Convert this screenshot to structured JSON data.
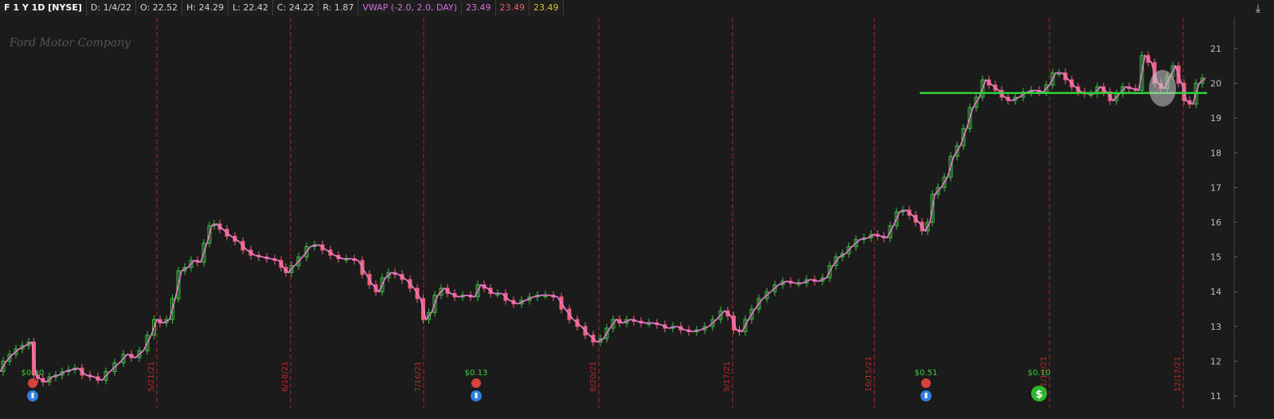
{
  "header": {
    "symbol": "F 1 Y 1D [NYSE]",
    "date": "D: 1/4/22",
    "open": "O: 22.52",
    "high": "H: 24.29",
    "low": "L: 22.42",
    "close": "C: 24.22",
    "range": "R: 1.87",
    "vwap_label": "VWAP (-2.0, 2.0, DAY)",
    "vwap_values": [
      "23.49",
      "23.49",
      "23.49"
    ]
  },
  "watermark": "Ford Motor Company",
  "colors": {
    "background": "#1b1b1b",
    "up": "#3fbf3f",
    "down": "#f0637a",
    "vwap": "#e97ad7",
    "vline": "#b0202a",
    "level": "#2fd23a",
    "grid": "#2a2a2a"
  },
  "chart_data": {
    "type": "line",
    "title": "",
    "xlabel": "",
    "ylabel": "",
    "ylim": [
      10.7,
      21.6
    ],
    "y_ticks": [
      "21",
      "20",
      "19",
      "18",
      "17",
      "16",
      "15",
      "14",
      "13",
      "12",
      "11"
    ],
    "x_date_labels": [
      "5/21/21",
      "6/18/21",
      "7/16/21",
      "8/20/21",
      "9/17/21",
      "10/15/21",
      "11/19/21",
      "12/17/21"
    ],
    "horizontal_level": 19.72,
    "close_series": [
      [
        0,
        11.7
      ],
      [
        8,
        12.0
      ],
      [
        16,
        12.2
      ],
      [
        24,
        12.35
      ],
      [
        32,
        12.45
      ],
      [
        40,
        12.55
      ],
      [
        45,
        11.6
      ],
      [
        50,
        11.5
      ],
      [
        58,
        11.4
      ],
      [
        66,
        11.55
      ],
      [
        74,
        11.6
      ],
      [
        82,
        11.7
      ],
      [
        90,
        11.75
      ],
      [
        98,
        11.8
      ],
      [
        108,
        11.6
      ],
      [
        118,
        11.55
      ],
      [
        128,
        11.45
      ],
      [
        138,
        11.7
      ],
      [
        150,
        11.95
      ],
      [
        160,
        12.2
      ],
      [
        170,
        12.1
      ],
      [
        180,
        12.3
      ],
      [
        190,
        12.75
      ],
      [
        197,
        13.2
      ],
      [
        205,
        13.1
      ],
      [
        213,
        13.2
      ],
      [
        220,
        13.8
      ],
      [
        228,
        14.6
      ],
      [
        236,
        14.7
      ],
      [
        244,
        14.9
      ],
      [
        252,
        14.85
      ],
      [
        260,
        15.4
      ],
      [
        266,
        15.9
      ],
      [
        272,
        15.95
      ],
      [
        280,
        15.8
      ],
      [
        290,
        15.6
      ],
      [
        300,
        15.45
      ],
      [
        310,
        15.2
      ],
      [
        320,
        15.05
      ],
      [
        330,
        15.0
      ],
      [
        340,
        14.95
      ],
      [
        350,
        14.9
      ],
      [
        356,
        14.7
      ],
      [
        362,
        14.55
      ],
      [
        370,
        14.75
      ],
      [
        380,
        15.0
      ],
      [
        390,
        15.3
      ],
      [
        400,
        15.35
      ],
      [
        410,
        15.2
      ],
      [
        420,
        15.05
      ],
      [
        430,
        14.95
      ],
      [
        440,
        14.95
      ],
      [
        450,
        14.9
      ],
      [
        460,
        14.5
      ],
      [
        468,
        14.2
      ],
      [
        476,
        14.0
      ],
      [
        484,
        14.4
      ],
      [
        492,
        14.55
      ],
      [
        500,
        14.5
      ],
      [
        510,
        14.35
      ],
      [
        520,
        14.1
      ],
      [
        528,
        13.8
      ],
      [
        535,
        13.2
      ],
      [
        542,
        13.4
      ],
      [
        550,
        13.9
      ],
      [
        558,
        14.1
      ],
      [
        566,
        13.95
      ],
      [
        576,
        13.85
      ],
      [
        586,
        13.9
      ],
      [
        596,
        13.85
      ],
      [
        604,
        14.2
      ],
      [
        612,
        14.1
      ],
      [
        620,
        13.95
      ],
      [
        630,
        13.95
      ],
      [
        640,
        13.75
      ],
      [
        650,
        13.65
      ],
      [
        660,
        13.75
      ],
      [
        670,
        13.85
      ],
      [
        680,
        13.9
      ],
      [
        690,
        13.9
      ],
      [
        700,
        13.85
      ],
      [
        710,
        13.5
      ],
      [
        720,
        13.2
      ],
      [
        730,
        13.0
      ],
      [
        740,
        12.75
      ],
      [
        750,
        12.55
      ],
      [
        758,
        12.65
      ],
      [
        766,
        12.95
      ],
      [
        774,
        13.2
      ],
      [
        782,
        13.1
      ],
      [
        792,
        13.2
      ],
      [
        800,
        13.15
      ],
      [
        810,
        13.1
      ],
      [
        820,
        13.1
      ],
      [
        830,
        13.05
      ],
      [
        840,
        12.95
      ],
      [
        850,
        13.0
      ],
      [
        860,
        12.9
      ],
      [
        870,
        12.85
      ],
      [
        880,
        12.9
      ],
      [
        890,
        13.0
      ],
      [
        900,
        13.2
      ],
      [
        910,
        13.45
      ],
      [
        918,
        13.3
      ],
      [
        925,
        12.9
      ],
      [
        932,
        12.85
      ],
      [
        940,
        13.2
      ],
      [
        948,
        13.5
      ],
      [
        958,
        13.8
      ],
      [
        968,
        14.0
      ],
      [
        978,
        14.2
      ],
      [
        988,
        14.3
      ],
      [
        998,
        14.25
      ],
      [
        1008,
        14.25
      ],
      [
        1018,
        14.35
      ],
      [
        1028,
        14.3
      ],
      [
        1038,
        14.4
      ],
      [
        1046,
        14.75
      ],
      [
        1054,
        15.0
      ],
      [
        1062,
        15.1
      ],
      [
        1070,
        15.3
      ],
      [
        1080,
        15.5
      ],
      [
        1090,
        15.55
      ],
      [
        1098,
        15.65
      ],
      [
        1106,
        15.6
      ],
      [
        1114,
        15.55
      ],
      [
        1122,
        15.9
      ],
      [
        1130,
        16.3
      ],
      [
        1138,
        16.35
      ],
      [
        1146,
        16.2
      ],
      [
        1154,
        16.0
      ],
      [
        1162,
        15.75
      ],
      [
        1168,
        16.0
      ],
      [
        1174,
        16.8
      ],
      [
        1182,
        17.0
      ],
      [
        1190,
        17.3
      ],
      [
        1198,
        17.9
      ],
      [
        1206,
        18.2
      ],
      [
        1214,
        18.7
      ],
      [
        1222,
        19.3
      ],
      [
        1230,
        19.6
      ],
      [
        1238,
        20.1
      ],
      [
        1246,
        19.95
      ],
      [
        1254,
        19.8
      ],
      [
        1262,
        19.6
      ],
      [
        1270,
        19.5
      ],
      [
        1280,
        19.6
      ],
      [
        1290,
        19.75
      ],
      [
        1300,
        19.8
      ],
      [
        1310,
        19.75
      ],
      [
        1318,
        19.95
      ],
      [
        1326,
        20.3
      ],
      [
        1334,
        20.3
      ],
      [
        1342,
        20.1
      ],
      [
        1350,
        19.9
      ],
      [
        1358,
        19.75
      ],
      [
        1366,
        19.7
      ],
      [
        1374,
        19.7
      ],
      [
        1382,
        19.9
      ],
      [
        1390,
        19.75
      ],
      [
        1398,
        19.5
      ],
      [
        1406,
        19.7
      ],
      [
        1414,
        19.9
      ],
      [
        1422,
        19.85
      ],
      [
        1430,
        19.8
      ],
      [
        1438,
        20.8
      ],
      [
        1446,
        20.6
      ],
      [
        1454,
        20.0
      ],
      [
        1462,
        19.85
      ],
      [
        1470,
        20.2
      ],
      [
        1476,
        20.5
      ],
      [
        1484,
        20.0
      ],
      [
        1490,
        19.5
      ],
      [
        1498,
        19.4
      ],
      [
        1506,
        20.0
      ],
      [
        1514,
        20.15
      ]
    ],
    "events": [
      {
        "label": "$0.10",
        "kind": "dividend",
        "x": 41
      },
      {
        "label": "$0.13",
        "kind": "dividend",
        "x": 598
      },
      {
        "label": "$0.51",
        "kind": "dividend",
        "x": 1163
      },
      {
        "label": "$0.10",
        "kind": "dividend-s",
        "x": 1305
      }
    ],
    "earnings": [
      {
        "x": 41
      },
      {
        "x": 598
      },
      {
        "x": 1163
      }
    ]
  },
  "vlines_x": [
    197,
    365,
    532,
    752,
    920,
    1098,
    1318,
    1486
  ]
}
